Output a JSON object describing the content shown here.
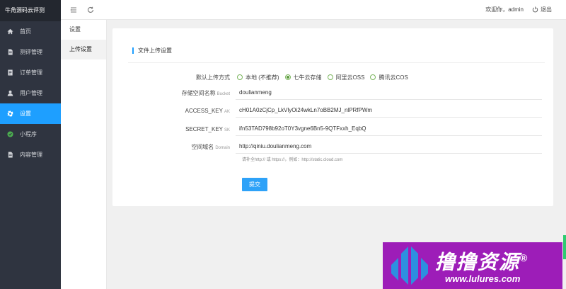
{
  "brand": "牛角源码云评测",
  "sidebar": {
    "items": [
      {
        "label": "首页",
        "icon": "home-icon",
        "active": false
      },
      {
        "label": "测评管理",
        "icon": "file-icon",
        "active": false
      },
      {
        "label": "订单管理",
        "icon": "order-icon",
        "active": false
      },
      {
        "label": "用户管理",
        "icon": "user-icon",
        "active": false
      },
      {
        "label": "设置",
        "icon": "gear-icon",
        "active": true
      },
      {
        "label": "小程序",
        "icon": "miniprogram-icon",
        "active": false
      },
      {
        "label": "内容管理",
        "icon": "file-icon",
        "active": false
      }
    ]
  },
  "header": {
    "welcome": "欢迎你，admin",
    "logout": "退出"
  },
  "subnav": {
    "items": [
      {
        "label": "设置",
        "active": false
      },
      {
        "label": "上传设置",
        "active": true
      }
    ]
  },
  "form": {
    "title": "文件上传设置",
    "upload_method": {
      "label": "默认上传方式",
      "options": [
        {
          "label": "本地 (不推荐)",
          "checked": false
        },
        {
          "label": "七牛云存储",
          "checked": true
        },
        {
          "label": "阿里云OSS",
          "checked": false
        },
        {
          "label": "腾讯云COS",
          "checked": false
        }
      ]
    },
    "bucket": {
      "label": "存储空间名称",
      "sub": "Bucket",
      "value": "doulianmeng"
    },
    "access_key": {
      "label": "ACCESS_KEY",
      "sub": "AK",
      "value": "cH01A0zCjCp_LkVlyOi24wkLn7oBB2MJ_nlPRfPWm"
    },
    "secret_key": {
      "label": "SECRET_KEY",
      "sub": "SK",
      "value": "ifn53TAD798b92oT0Y3vgne6Bn5-9QTFxxh_EqbQ"
    },
    "domain": {
      "label": "空间域名",
      "sub": "Domain",
      "value": "http://qiniu.doulianmeng.com"
    },
    "hint": "请补全http:// 或 https://，例如：http://static.cloud.com",
    "submit": "提交"
  },
  "watermark": {
    "title": "撸撸资源",
    "mark": "®",
    "url": "www.lulures.com"
  },
  "colors": {
    "sidebar_bg": "#2f3440",
    "accent": "#1e9fff",
    "radio": "#5a9a3b",
    "banner": "#9d1db8"
  }
}
